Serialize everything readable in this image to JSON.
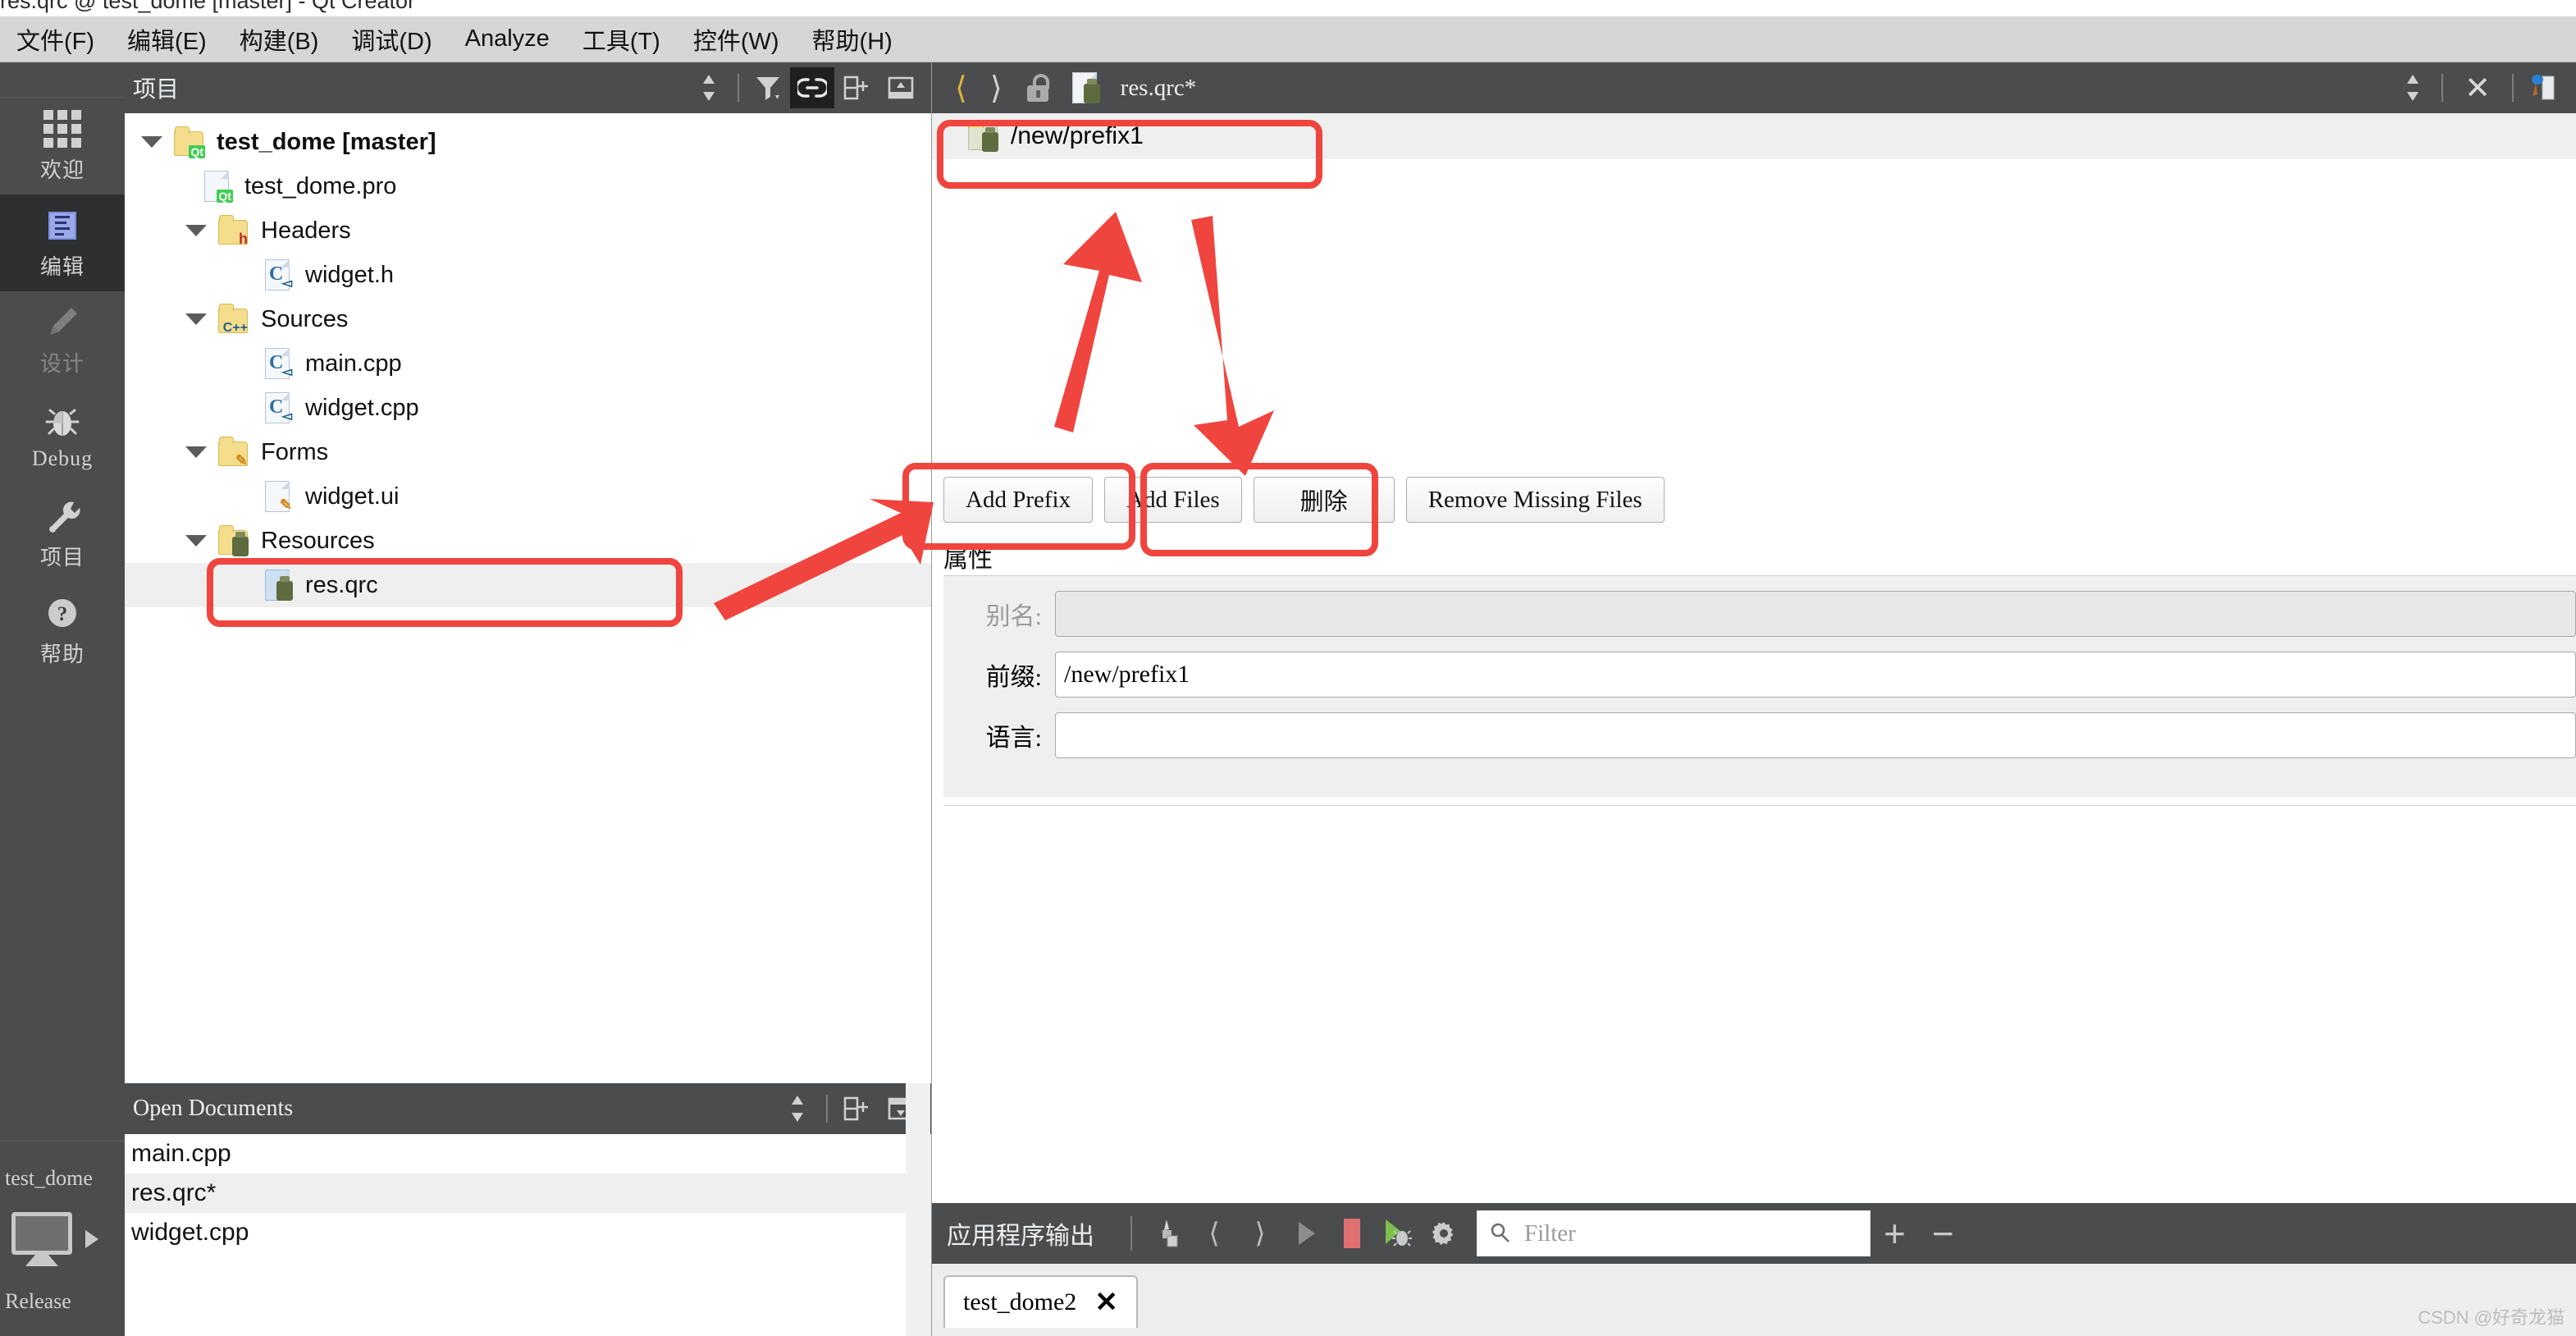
{
  "window": {
    "title": "res.qrc @ test_dome [master] - Qt Creator"
  },
  "menubar": {
    "items": [
      {
        "label": "文件(F)",
        "mnemonic": "F"
      },
      {
        "label": "编辑(E)",
        "mnemonic": "E"
      },
      {
        "label": "构建(B)",
        "mnemonic": "B"
      },
      {
        "label": "调试(D)",
        "mnemonic": "D"
      },
      {
        "label": "Analyze",
        "mnemonic": "A"
      },
      {
        "label": "工具(T)",
        "mnemonic": "T"
      },
      {
        "label": "控件(W)",
        "mnemonic": "W"
      },
      {
        "label": "帮助(H)",
        "mnemonic": "H"
      }
    ]
  },
  "modebar": {
    "items": [
      {
        "label": "欢迎",
        "icon": "grid-icon",
        "state": "normal"
      },
      {
        "label": "编辑",
        "icon": "document-icon",
        "state": "active"
      },
      {
        "label": "设计",
        "icon": "pencil-icon",
        "state": "disabled"
      },
      {
        "label": "Debug",
        "icon": "bug-icon",
        "state": "normal"
      },
      {
        "label": "项目",
        "icon": "wrench-icon",
        "state": "normal"
      },
      {
        "label": "帮助",
        "icon": "question-icon",
        "state": "normal"
      }
    ],
    "kit": {
      "project": "test_dome",
      "build_config": "Release",
      "icon": "desktop-kit-icon",
      "run_arrow": "play-arrow-icon"
    }
  },
  "project_panel": {
    "title": "项目",
    "toolbar": [
      {
        "name": "sort-updown-icon",
        "label": "⇅"
      },
      {
        "name": "filter-icon",
        "label": "filter"
      },
      {
        "name": "link-icon",
        "label": "link",
        "selected": true
      },
      {
        "name": "split-icon",
        "label": "split"
      },
      {
        "name": "minimize-icon",
        "label": "minimize"
      }
    ],
    "tree": [
      {
        "label": "test_dome [master]",
        "indent": 0,
        "expanded": true,
        "icon": "qt-folder-icon",
        "bold": true
      },
      {
        "label": "test_dome.pro",
        "indent": 1,
        "expanded": null,
        "icon": "qt-file-icon",
        "bold": false
      },
      {
        "label": "Headers",
        "indent": 1,
        "expanded": true,
        "icon": "h-folder-icon",
        "bold": false
      },
      {
        "label": "widget.h",
        "indent": 2,
        "expanded": null,
        "icon": "c-file-icon",
        "bold": false
      },
      {
        "label": "Sources",
        "indent": 1,
        "expanded": true,
        "icon": "cpp-folder-icon",
        "bold": false
      },
      {
        "label": "main.cpp",
        "indent": 2,
        "expanded": null,
        "icon": "cpp-file-icon",
        "bold": false
      },
      {
        "label": "widget.cpp",
        "indent": 2,
        "expanded": null,
        "icon": "cpp-file-icon",
        "bold": false
      },
      {
        "label": "Forms",
        "indent": 1,
        "expanded": true,
        "icon": "ui-folder-icon",
        "bold": false
      },
      {
        "label": "widget.ui",
        "indent": 2,
        "expanded": null,
        "icon": "ui-file-icon",
        "bold": false
      },
      {
        "label": "Resources",
        "indent": 1,
        "expanded": true,
        "icon": "qrc-folder-icon",
        "bold": false
      },
      {
        "label": "res.qrc",
        "indent": 2,
        "expanded": null,
        "icon": "qrc-file-icon",
        "bold": false,
        "selected": true
      }
    ]
  },
  "open_documents": {
    "title": "Open Documents",
    "toolbar": [
      {
        "name": "sort-updown-icon",
        "label": "⇅"
      },
      {
        "name": "split-icon",
        "label": "split"
      },
      {
        "name": "close-split-icon",
        "label": "close"
      }
    ],
    "items": [
      {
        "label": "main.cpp",
        "selected": false
      },
      {
        "label": "res.qrc*",
        "selected": true
      },
      {
        "label": "widget.cpp",
        "selected": false
      }
    ]
  },
  "editor": {
    "toolbar": {
      "back_icon": "chevron-left-icon",
      "forward_icon": "chevron-right-icon",
      "lock_icon": "unlock-icon",
      "file_icon": "qrc-file-icon",
      "filename": "res.qrc*",
      "sort_icon": "sort-updown-icon",
      "close_icon": "close-icon",
      "split_icon": "editor-split-icon"
    },
    "resource_tree": [
      {
        "label": "/new/prefix1",
        "icon": "qrc-folder-icon"
      }
    ],
    "buttons": [
      {
        "label": "Add Prefix",
        "highlighted": true
      },
      {
        "label": "Add Files",
        "highlighted": true
      },
      {
        "label": "删除",
        "highlighted": false
      },
      {
        "label": "Remove Missing Files",
        "highlighted": false
      }
    ],
    "properties": {
      "title": "属性",
      "fields": [
        {
          "label": "别名:",
          "value": "",
          "disabled": true
        },
        {
          "label": "前缀:",
          "value": "/new/prefix1",
          "disabled": false
        },
        {
          "label": "语言:",
          "value": "",
          "disabled": false
        }
      ]
    }
  },
  "output_pane": {
    "title": "应用程序输出",
    "icons": [
      {
        "name": "clear-output-icon"
      },
      {
        "name": "prev-item-icon"
      },
      {
        "name": "next-item-icon"
      },
      {
        "name": "run-icon"
      },
      {
        "name": "stop-icon",
        "color": "#e07070"
      },
      {
        "name": "debug-run-icon",
        "color": "#7fbf4f"
      },
      {
        "name": "settings-gear-icon"
      }
    ],
    "filter": {
      "placeholder": "Filter",
      "value": "",
      "icon": "search-icon"
    },
    "zoom_in": "+",
    "zoom_out": "−",
    "tabs": [
      {
        "label": "test_dome2",
        "close_icon": "close-icon",
        "active": true
      }
    ]
  },
  "watermark": "CSDN @好奇龙猫",
  "colors": {
    "annotation": "#f0453f",
    "panel_dark": "#4a4c4e",
    "mode_active": "#2e2f30",
    "menu_bg": "#d6d6d6",
    "selection": "#efefef"
  }
}
